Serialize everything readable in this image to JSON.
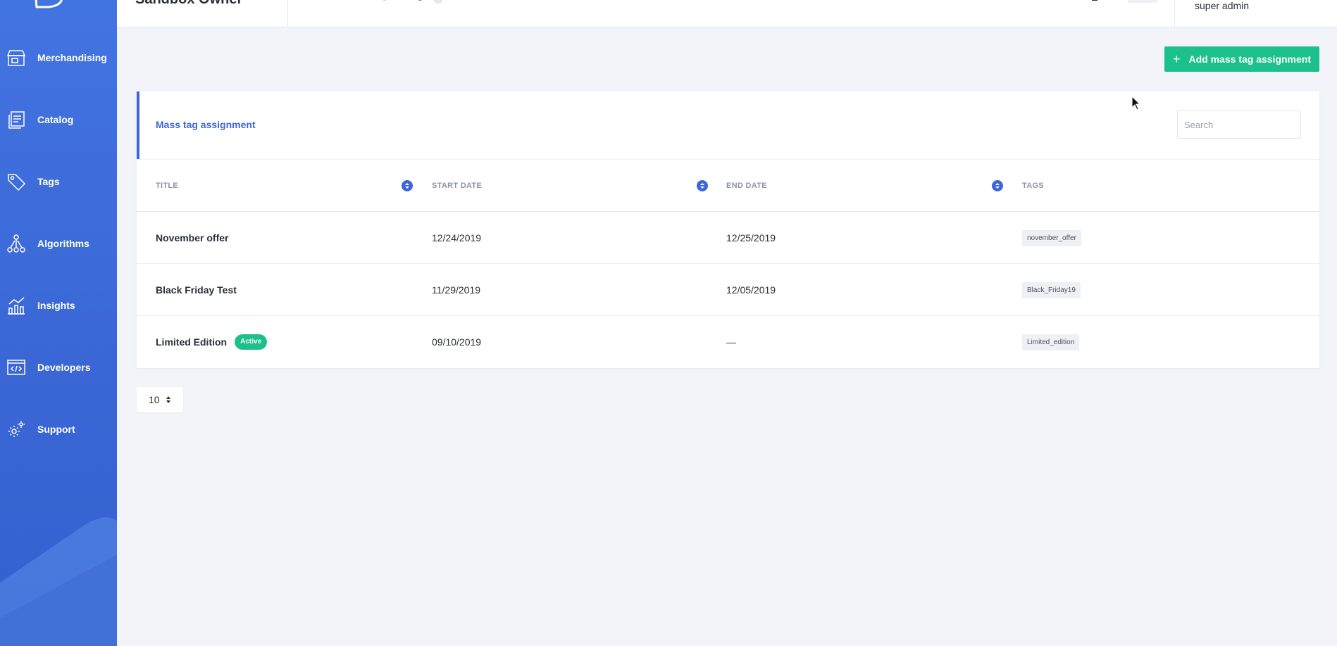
{
  "colors": {
    "sidebar": "#3b67d6",
    "accent": "#3c67d8",
    "success": "#1cc08a"
  },
  "topbar": {
    "title": "Sandbox Owner",
    "user_role": "super admin"
  },
  "sidebar": {
    "items": [
      {
        "label": "Merchandising",
        "icon": "store-icon"
      },
      {
        "label": "Catalog",
        "icon": "catalog-icon"
      },
      {
        "label": "Tags",
        "icon": "tag-icon"
      },
      {
        "label": "Algorithms",
        "icon": "algorithm-icon"
      },
      {
        "label": "Insights",
        "icon": "chart-icon"
      },
      {
        "label": "Developers",
        "icon": "code-icon"
      },
      {
        "label": "Support",
        "icon": "gear-icon"
      }
    ]
  },
  "actions": {
    "add_label": "Add mass tag assignment"
  },
  "card": {
    "title": "Mass tag assignment",
    "search_placeholder": "Search",
    "columns": [
      "TITLE",
      "START DATE",
      "END DATE",
      "TAGS"
    ],
    "rows": [
      {
        "title": "November offer",
        "start": "12/24/2019",
        "end": "12/25/2019",
        "tag": "november_offer",
        "badge": ""
      },
      {
        "title": "Black Friday Test",
        "start": "11/29/2019",
        "end": "12/05/2019",
        "tag": "Black_Friday19",
        "badge": ""
      },
      {
        "title": "Limited Edition",
        "start": "09/10/2019",
        "end": "—",
        "tag": "Limited_edition",
        "badge": "Active"
      }
    ]
  },
  "pagination": {
    "page_size": "10"
  }
}
